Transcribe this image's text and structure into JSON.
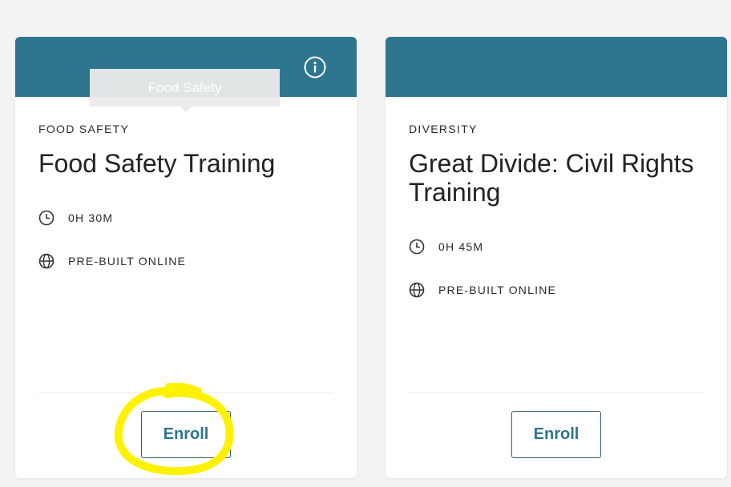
{
  "colors": {
    "accent": "#2e7590",
    "highlight": "#fff200"
  },
  "cards": [
    {
      "tooltip": "Food Safety",
      "category": "FOOD SAFETY",
      "title": "Food Safety Training",
      "duration": "0H 30M",
      "format": "PRE-BUILT ONLINE",
      "enroll_label": "Enroll",
      "icons": [
        "info-icon",
        "clock-icon",
        "globe-icon"
      ]
    },
    {
      "category": "DIVERSITY",
      "title": "Great Divide: Civil Rights Training",
      "duration": "0H 45M",
      "format": "PRE-BUILT ONLINE",
      "enroll_label": "Enroll",
      "icons": [
        "clock-icon",
        "globe-icon"
      ]
    }
  ]
}
